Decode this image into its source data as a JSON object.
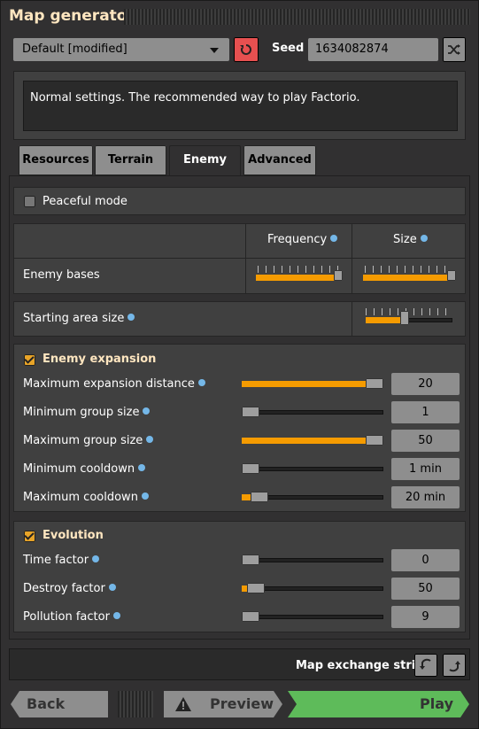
{
  "window": {
    "title": "Map generator"
  },
  "preset": {
    "selected": "Default [modified]"
  },
  "seed": {
    "label": "Seed",
    "value": "1634082874"
  },
  "description": "Normal settings. The recommended way to play Factorio.",
  "tabs": [
    {
      "label": "Resources",
      "active": false
    },
    {
      "label": "Terrain",
      "active": false
    },
    {
      "label": "Enemy",
      "active": true
    },
    {
      "label": "Advanced",
      "active": false
    }
  ],
  "enemy": {
    "peaceful_mode": {
      "label": "Peaceful mode",
      "checked": false
    },
    "headers": {
      "frequency": "Frequency",
      "size": "Size"
    },
    "enemy_bases": {
      "label": "Enemy bases",
      "frequency_level": 1.0,
      "size_level": 1.0
    },
    "starting_area": {
      "label": "Starting area size",
      "level": 0.45
    },
    "expansion": {
      "title": "Enemy expansion",
      "checked": true,
      "rows": [
        {
          "label": "Maximum expansion distance",
          "value": "20",
          "level": 1.0
        },
        {
          "label": "Minimum group size",
          "value": "1",
          "level": 0.0
        },
        {
          "label": "Maximum group size",
          "value": "50",
          "level": 1.0
        },
        {
          "label": "Minimum cooldown",
          "value": "1 min",
          "level": 0.0
        },
        {
          "label": "Maximum cooldown",
          "value": "20 min",
          "level": 0.06
        }
      ]
    },
    "evolution": {
      "title": "Evolution",
      "checked": true,
      "rows": [
        {
          "label": "Time factor",
          "value": "0",
          "level": 0.0
        },
        {
          "label": "Destroy factor",
          "value": "50",
          "level": 0.04
        },
        {
          "label": "Pollution factor",
          "value": "9",
          "level": 0.0
        }
      ]
    }
  },
  "footer": {
    "map_exchange_label": "Map exchange string",
    "back_label": "Back",
    "preview_label": "Preview",
    "play_label": "Play"
  },
  "colors": {
    "accent": "#f59b00",
    "play": "#5ebb5a",
    "reset": "#e65050"
  },
  "icons": [
    "reset-icon",
    "shuffle-icon",
    "info-icon",
    "warning-icon",
    "import-icon",
    "export-icon"
  ]
}
